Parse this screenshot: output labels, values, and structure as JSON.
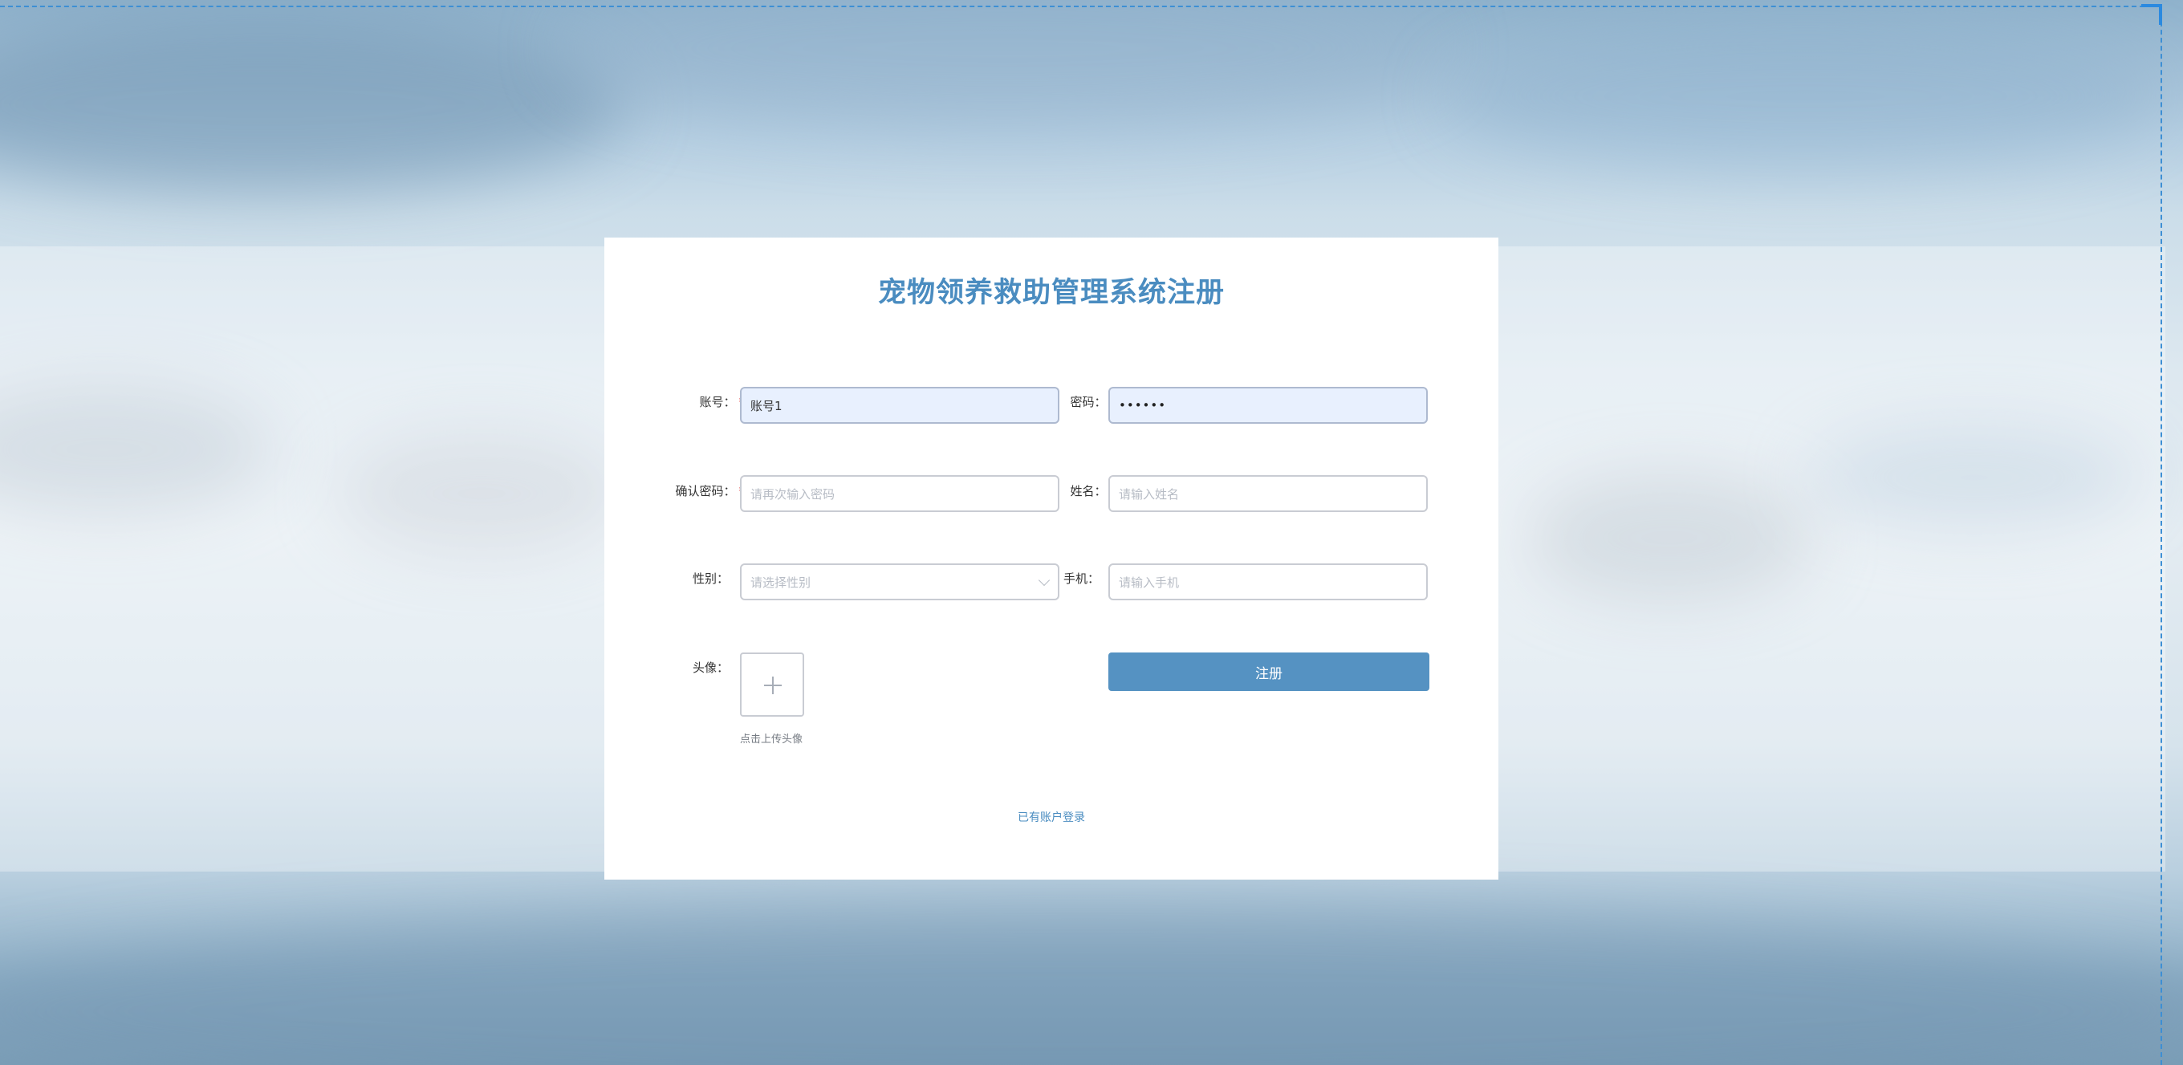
{
  "form": {
    "title": "宠物领养救助管理系统注册",
    "account": {
      "label": "账号：",
      "required_mark": "*",
      "value": "账号1"
    },
    "password": {
      "label": "密码：",
      "required_mark": "*",
      "value": "••••••"
    },
    "confirm_password": {
      "label": "确认密码：",
      "required_mark": "*",
      "placeholder": "请再次输入密码"
    },
    "name": {
      "label": "姓名：",
      "required_mark": "*",
      "placeholder": "请输入姓名"
    },
    "gender": {
      "label": "性别：",
      "placeholder": "请选择性别"
    },
    "phone": {
      "label": "手机：",
      "placeholder": "请输入手机"
    },
    "avatar": {
      "label": "头像：",
      "tip": "点击上传头像"
    },
    "register_label": "注册",
    "login_link": "已有账户登录"
  },
  "colors": {
    "title": "#4a8cc0",
    "button": "#5592c2",
    "required": "#e24b4b",
    "filled_input_bg": "#e8f0fe"
  },
  "icons": {
    "upload": "plus-icon",
    "select": "chevron-down-icon"
  }
}
